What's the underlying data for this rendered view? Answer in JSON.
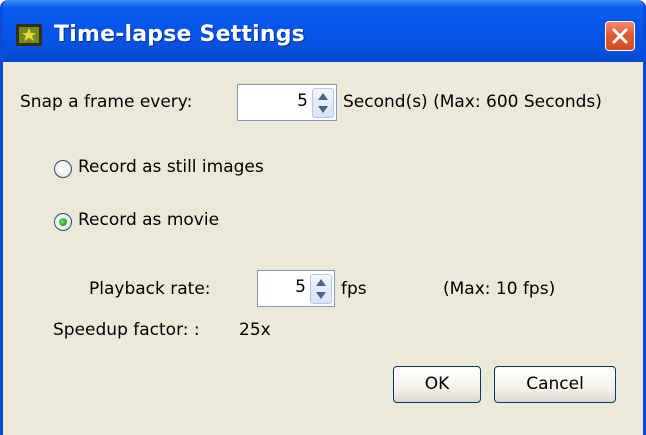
{
  "window": {
    "title": "Time-lapse Settings"
  },
  "snap": {
    "label": "Snap a frame every:",
    "value": "5",
    "unit": "Second(s) (Max: 600 Seconds)"
  },
  "record": {
    "still_label": "Record as still images",
    "movie_label": "Record as movie",
    "selected": "movie"
  },
  "playback": {
    "label": "Playback rate:",
    "value": "5",
    "unit": "fps",
    "max": "(Max: 10 fps)"
  },
  "speedup": {
    "label": "Speedup factor: :",
    "value": "25x"
  },
  "buttons": {
    "ok": "OK",
    "cancel": "Cancel"
  },
  "colors": {
    "titlebar": "#0654E8",
    "window_bg": "#ECE9D8",
    "close": "#E05A34",
    "radio_dot": "#21A121"
  },
  "icons": {
    "app": "film-star-icon",
    "close": "close-icon",
    "spin": "spin-up-down-icon"
  }
}
